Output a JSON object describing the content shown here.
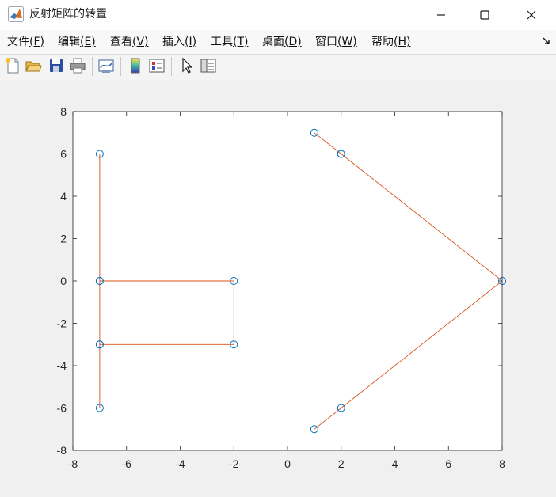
{
  "window": {
    "title": "反射矩阵的转置",
    "controls": {
      "minimize": "minimize-icon",
      "maximize": "maximize-icon",
      "close": "close-icon"
    }
  },
  "menu": {
    "items": [
      {
        "label": "文件",
        "accel": "(F)"
      },
      {
        "label": "编辑",
        "accel": "(E)"
      },
      {
        "label": "查看",
        "accel": "(V)"
      },
      {
        "label": "插入",
        "accel": "(I)"
      },
      {
        "label": "工具",
        "accel": "(T)"
      },
      {
        "label": "桌面",
        "accel": "(D)"
      },
      {
        "label": "窗口",
        "accel": "(W)"
      },
      {
        "label": "帮助",
        "accel": "(H)"
      }
    ]
  },
  "toolbar": {
    "icons": [
      "new-figure-icon",
      "open-file-icon",
      "save-icon",
      "print-icon",
      "link-plot-icon",
      "colorbar-icon",
      "legend-icon",
      "pointer-icon",
      "property-inspector-icon"
    ]
  },
  "colors": {
    "line": "#d95319",
    "marker": "#0072bd",
    "axes_bg": "#ffffff",
    "figure_bg": "#f0f0f0",
    "axis": "#262626"
  },
  "chart_data": {
    "type": "line",
    "xlim": [
      -8,
      8
    ],
    "ylim": [
      -8,
      8
    ],
    "xticks": [
      "-8",
      "-6",
      "-4",
      "-2",
      "0",
      "2",
      "4",
      "6",
      "8"
    ],
    "yticks": [
      "8",
      "6",
      "4",
      "2",
      "0",
      "-2",
      "-4",
      "-6",
      "-8"
    ],
    "grid": false,
    "series": [
      {
        "x": [
          1,
          2,
          8,
          2,
          1
        ],
        "y": [
          7,
          6,
          0,
          -6,
          -7
        ],
        "style": "line-with-circle-markers"
      },
      {
        "x": [
          2,
          -7,
          -7,
          -7,
          -7,
          -7,
          -2,
          -2,
          -7
        ],
        "y": [
          6,
          6,
          0,
          -3,
          -6,
          0,
          0,
          -3,
          -3
        ],
        "style": "line-with-circle-markers"
      },
      {
        "x": [
          -7,
          2
        ],
        "y": [
          -6,
          -6
        ],
        "style": "line"
      }
    ]
  }
}
